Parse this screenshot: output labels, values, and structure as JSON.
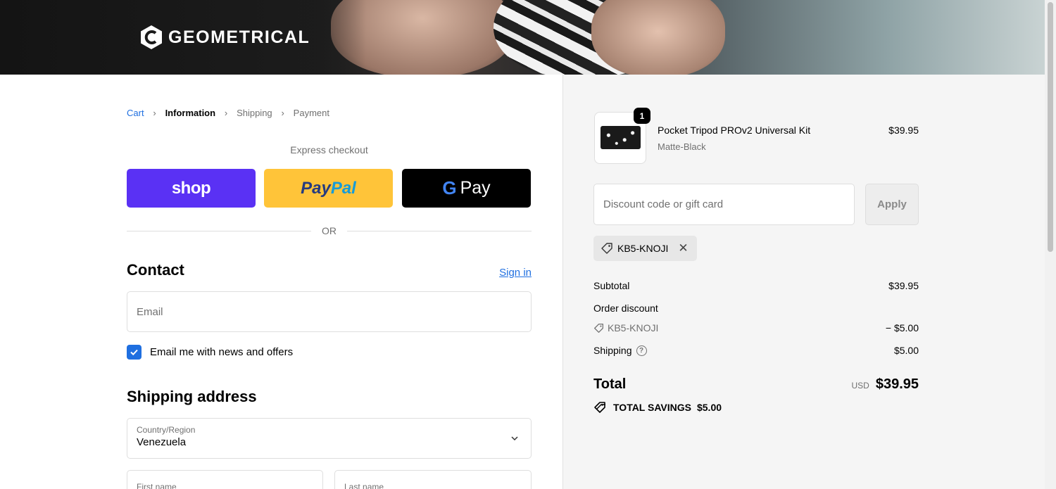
{
  "brand": {
    "name": "GEOMETRICAL"
  },
  "breadcrumb": {
    "cart": "Cart",
    "information": "Information",
    "shipping": "Shipping",
    "payment": "Payment"
  },
  "express": {
    "title": "Express checkout",
    "shop_label": "shop",
    "paypal_part1": "Pay",
    "paypal_part2": "Pal",
    "gpay_g": "G",
    "gpay_label": "Pay"
  },
  "divider_label": "OR",
  "contact": {
    "heading": "Contact",
    "sign_in": "Sign in",
    "email_placeholder": "Email",
    "newsletter_label": "Email me with news and offers",
    "newsletter_checked": true
  },
  "shipping_address": {
    "heading": "Shipping address",
    "country_label": "Country/Region",
    "country_value": "Venezuela",
    "first_name_placeholder": "First name",
    "last_name_placeholder": "Last name"
  },
  "order": {
    "item": {
      "name": "Pocket Tripod PROv2 Universal Kit",
      "variant": "Matte-Black",
      "price": "$39.95",
      "quantity": "1"
    },
    "discount_placeholder": "Discount code or gift card",
    "apply_label": "Apply",
    "applied_code": "KB5-KNOJI",
    "subtotal_label": "Subtotal",
    "subtotal_value": "$39.95",
    "order_discount_label": "Order discount",
    "discount_code": "KB5-KNOJI",
    "discount_value": "− $5.00",
    "shipping_label": "Shipping",
    "shipping_value": "$5.00",
    "total_label": "Total",
    "currency": "USD",
    "total_value": "$39.95",
    "savings_label": "TOTAL SAVINGS",
    "savings_value": "$5.00"
  },
  "colors": {
    "shop_pay": "#5a31f4",
    "paypal": "#ffc439",
    "link": "#1f6fe0",
    "summary_bg": "#f5f5f5"
  }
}
